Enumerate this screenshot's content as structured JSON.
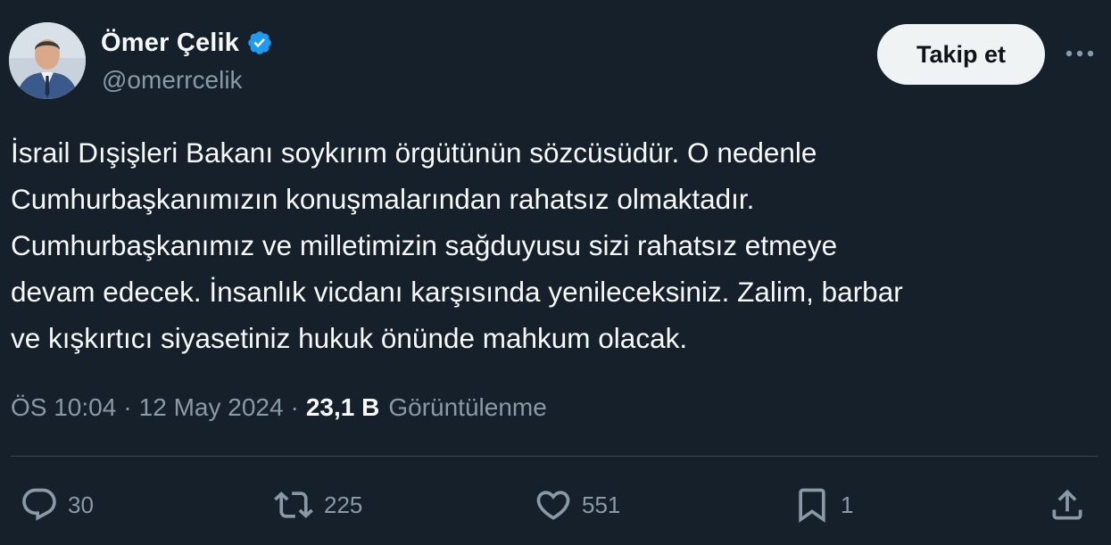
{
  "author": {
    "display_name": "Ömer Çelik",
    "handle": "@omerrcelik",
    "verified": true
  },
  "follow_button": {
    "label": "Takip et"
  },
  "tweet": {
    "text": "İsrail Dışişleri Bakanı soykırım örgütünün sözcüsüdür. O nedenle\nCumhurbaşkanımızın konuşmalarından rahatsız olmaktadır.\nCumhurbaşkanımız ve milletimizin sağduyusu sizi rahatsız etmeye\ndevam edecek. İnsanlık vicdanı karşısında yenileceksiniz. Zalim, barbar\nve kışkırtıcı siyasetiniz hukuk önünde mahkum olacak."
  },
  "meta": {
    "time": "ÖS 10:04",
    "separator": "·",
    "date": "12 May 2024",
    "views_count": "23,1 B",
    "views_label": "Görüntülenme"
  },
  "actions": {
    "replies": "30",
    "retweets": "225",
    "likes": "551",
    "bookmarks": "1"
  },
  "colors": {
    "background": "#15202b",
    "text_primary": "#f7f9f9",
    "text_secondary": "#8b98a5",
    "verified_blue": "#1d9bf0",
    "follow_button_bg": "#eff3f4",
    "divider": "#38444d"
  },
  "icons": {
    "verified": "verified-badge-icon",
    "more": "more-dots-icon",
    "reply": "reply-bubble-icon",
    "retweet": "retweet-arrows-icon",
    "like": "heart-icon",
    "bookmark": "bookmark-icon",
    "share": "share-upload-icon"
  }
}
